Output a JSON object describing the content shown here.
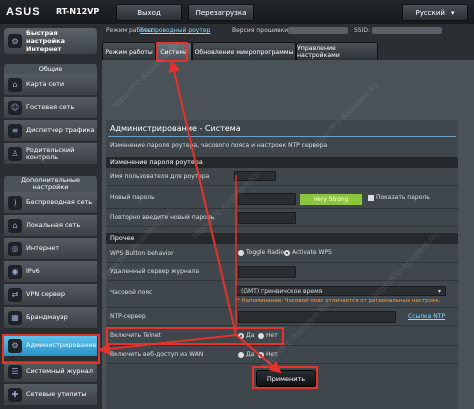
{
  "header": {
    "brand": "ASUS",
    "model": "RT-N12VP",
    "logout_label": "Выход",
    "reboot_label": "Перезагрузка",
    "language": "Русский"
  },
  "infobar": {
    "mode_label": "Режим работы:",
    "mode_value": "Беспроводный роутер",
    "firmware_label": "Версия прошивки:",
    "ssid_label": "SSID:"
  },
  "sidebar": {
    "quick_setup": "Быстрая настройка Интернет",
    "general_head": "Общие",
    "general": [
      {
        "label": "Карта сети",
        "icon": "network-map-icon"
      },
      {
        "label": "Гостевая сеть",
        "icon": "guest-network-icon"
      },
      {
        "label": "Диспетчер трафика",
        "icon": "traffic-manager-icon"
      },
      {
        "label": "Родительский контроль",
        "icon": "parental-control-icon"
      }
    ],
    "advanced_head": "Дополнительные настройки",
    "advanced": [
      {
        "label": "Беспроводная сеть",
        "icon": "wireless-icon"
      },
      {
        "label": "Локальная сеть",
        "icon": "lan-icon"
      },
      {
        "label": "Интернет",
        "icon": "internet-icon"
      },
      {
        "label": "IPv6",
        "icon": "ipv6-icon"
      },
      {
        "label": "VPN сервер",
        "icon": "vpn-icon"
      },
      {
        "label": "Брандмауэр",
        "icon": "firewall-icon"
      },
      {
        "label": "Администрирование",
        "icon": "admin-icon"
      },
      {
        "label": "Системный журнал",
        "icon": "syslog-icon"
      },
      {
        "label": "Сетевые утилиты",
        "icon": "network-tools-icon"
      }
    ]
  },
  "tabs": [
    "Режим работы",
    "Система",
    "Обновление микропрограммы",
    "Управление настройками"
  ],
  "page": {
    "title": "Администрирование - Система",
    "description": "Изменение пароля роутера, часового пояса и настроек NTP сервера"
  },
  "section1": {
    "title": "Изменение пароля роутера",
    "username_label": "Имя пользователя для роутера",
    "password_label": "Новый пароль",
    "strength": "Very Strong",
    "show_password_label": "Показать пароль",
    "confirm_label": "Повторно введите новый пароль"
  },
  "section2": {
    "title": "Прочее",
    "wps_label": "WPS Button behavior",
    "wps_option1": "Toggle Radio",
    "wps_option2": "Activate WPS",
    "syslog_label": "Удаленный сервер журнала",
    "timezone_label": "Часовой пояс",
    "timezone_value": "(GMT) гринвичское время",
    "timezone_warning": "* Напоминание: Часовой пояс отличается от региональных настроек.",
    "ntp_label": "NTP-сервер",
    "ntp_link": "Ссылка NTP",
    "telnet_label": "Включить Telnet",
    "wan_label": "Включить веб-доступ из WAN",
    "yes": "Да",
    "no": "Нет"
  },
  "apply_label": "Применить",
  "watermark": "https://Pc-Assistent.Ru",
  "colors": {
    "accent": "#2a8fc2",
    "highlight": "#e5322b",
    "strength": "#8cc63f",
    "warning": "#ff9e3d"
  }
}
